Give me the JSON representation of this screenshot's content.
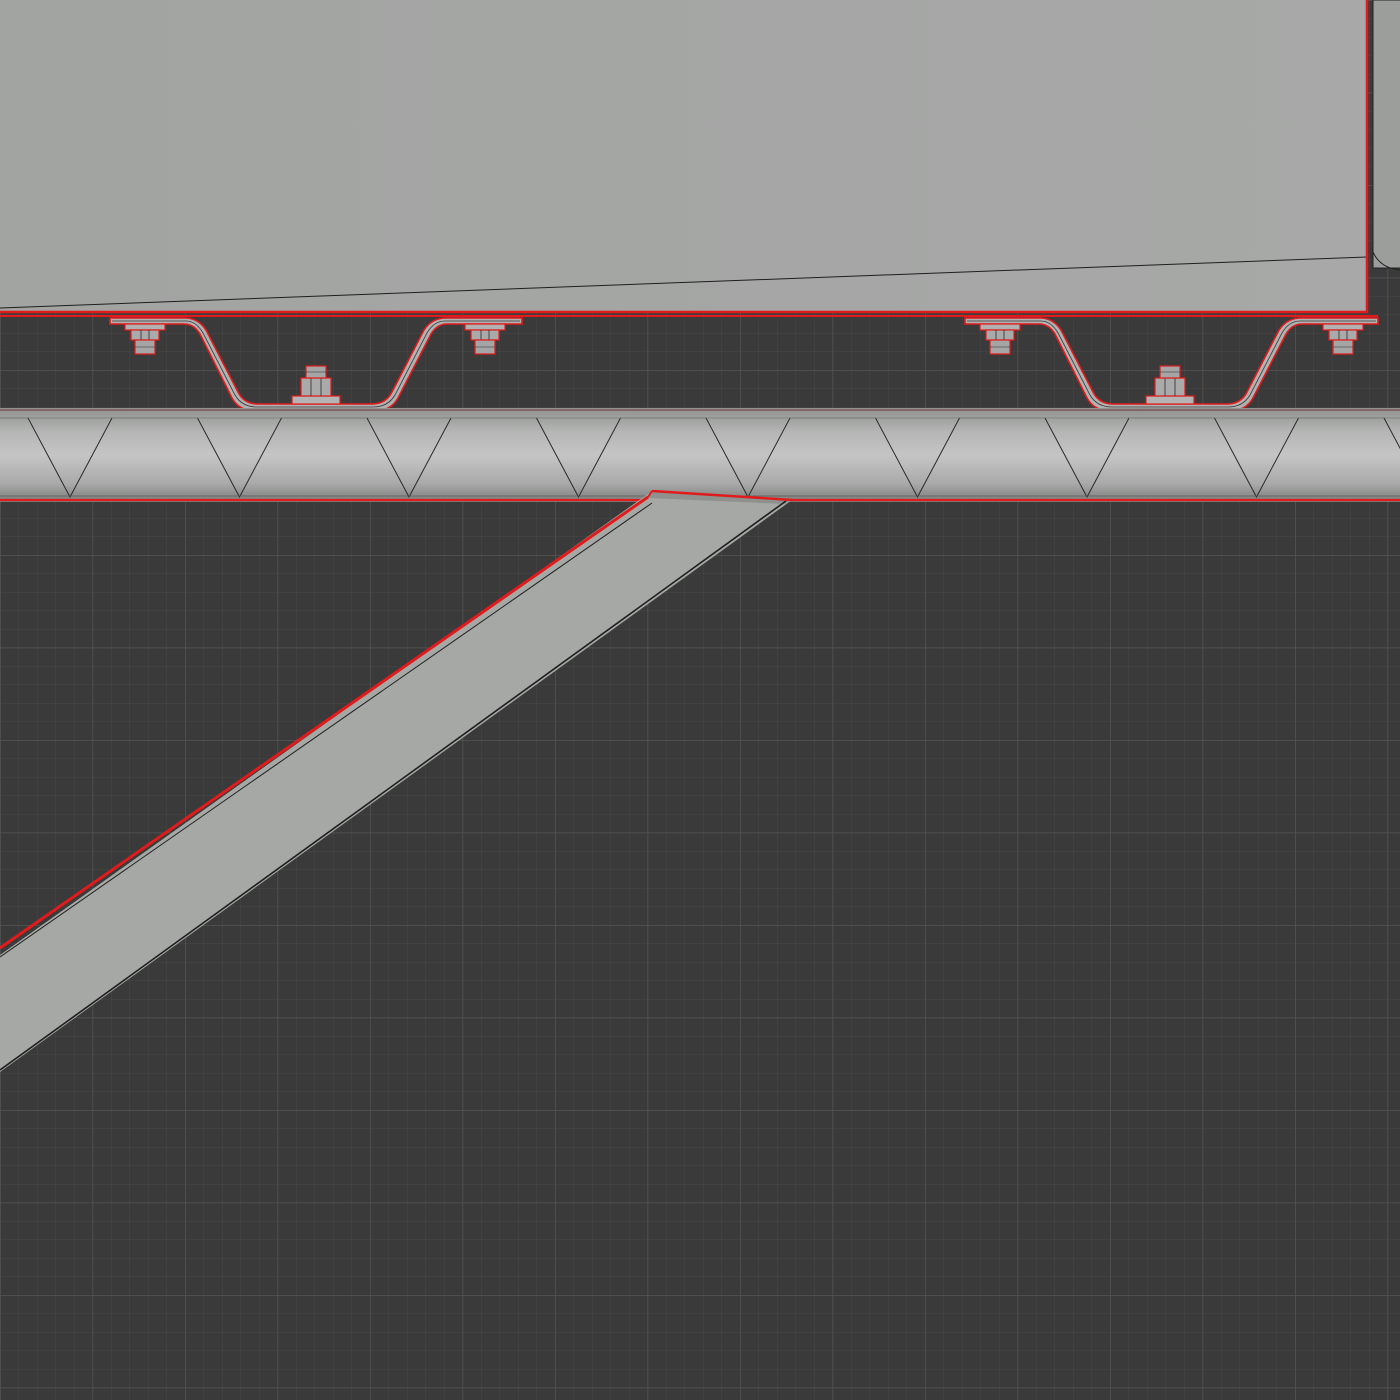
{
  "viewport": {
    "label": "",
    "mode": "orthographic",
    "view": "side",
    "selection": "active",
    "grid": true
  },
  "colors": {
    "background": "#3a3a3a",
    "grid_minor": "#474747",
    "grid_major": "#535353",
    "surface": "#a4a6a4",
    "surface_light": "#b9bab9",
    "surface_dark": "#8e908e",
    "edge": "#222222",
    "selection_outline": "#e11b1b"
  },
  "scene": {
    "objects": [
      "upper-panel",
      "hat-channel-left",
      "hat-channel-right",
      "bolt-assemblies",
      "spiral-ribbed-pipe",
      "diagonal-brace"
    ],
    "selected_objects": [
      "upper-panel",
      "hat-channel-left",
      "hat-channel-right",
      "spiral-ribbed-pipe",
      "diagonal-brace"
    ]
  }
}
